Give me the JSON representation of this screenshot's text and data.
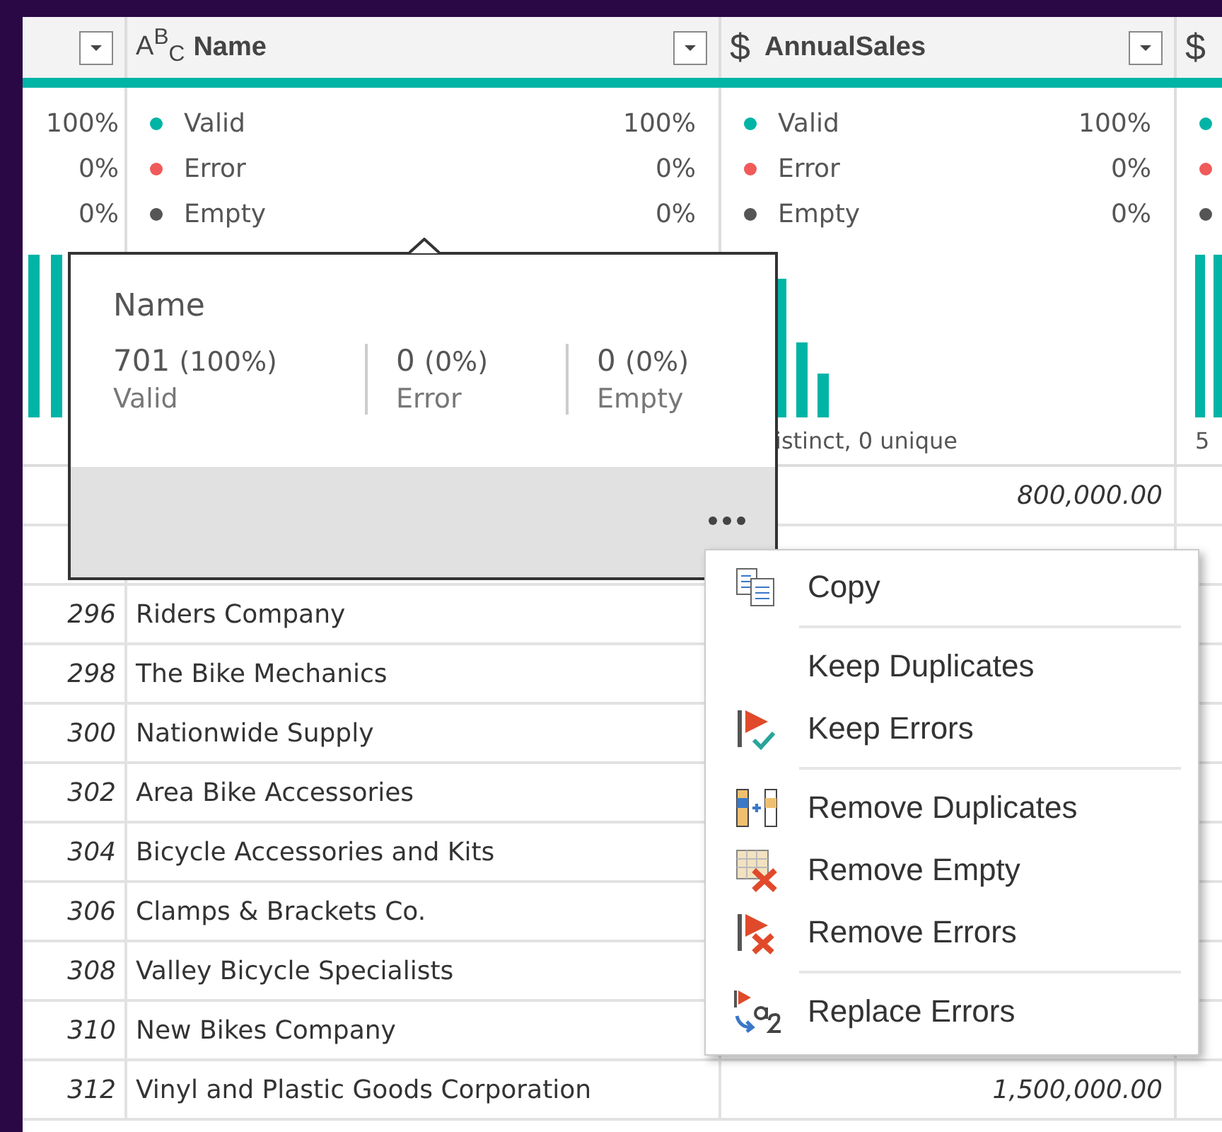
{
  "columns": [
    {
      "kind": "index",
      "stats": [
        {
          "percent": "100%"
        },
        {
          "percent": "0%"
        },
        {
          "percent": "0%"
        }
      ]
    },
    {
      "kind": "text",
      "type_icon": "A$^{B}$$_{C}$",
      "name": "Name",
      "stats": [
        {
          "label": "Valid",
          "percent": "100%",
          "color": "#00b4a6"
        },
        {
          "label": "Error",
          "percent": "0%",
          "color": "#f05a5a"
        },
        {
          "label": "Empty",
          "percent": "0%",
          "color": "#555555"
        }
      ]
    },
    {
      "kind": "currency",
      "type_icon": "$",
      "name": "AnnualSales",
      "stats": [
        {
          "label": "Valid",
          "percent": "100%",
          "color": "#00b4a6"
        },
        {
          "label": "Error",
          "percent": "0%",
          "color": "#f05a5a"
        },
        {
          "label": "Empty",
          "percent": "0%",
          "color": "#555555"
        }
      ],
      "footer": "istinct, 0 unique"
    },
    {
      "kind": "currency",
      "type_icon": "$",
      "stats": [
        {
          "color": "#00b4a6"
        },
        {
          "color": "#f05a5a"
        },
        {
          "color": "#555555"
        }
      ],
      "footer": "5"
    }
  ],
  "rows": [
    {
      "annual_sales": "800,000.00"
    },
    {},
    {
      "index": "296",
      "name": "Riders Company"
    },
    {
      "index": "298",
      "name": "The Bike Mechanics"
    },
    {
      "index": "300",
      "name": "Nationwide Supply"
    },
    {
      "index": "302",
      "name": "Area Bike Accessories"
    },
    {
      "index": "304",
      "name": "Bicycle Accessories and Kits"
    },
    {
      "index": "306",
      "name": "Clamps & Brackets Co."
    },
    {
      "index": "308",
      "name": "Valley Bicycle Specialists"
    },
    {
      "index": "310",
      "name": "New Bikes Company"
    },
    {
      "index": "312",
      "name": "Vinyl and Plastic Goods Corporation",
      "annual_sales": "1,500,000.00"
    }
  ],
  "popup": {
    "title": "Name",
    "stats": [
      {
        "value": "701",
        "percent": "(100%)",
        "label": "Valid"
      },
      {
        "value": "0",
        "percent": "(0%)",
        "label": "Error"
      },
      {
        "value": "0",
        "percent": "(0%)",
        "label": "Empty"
      }
    ]
  },
  "menu": {
    "groups": [
      [
        {
          "label": "Copy"
        }
      ],
      [
        {
          "label": "Keep Duplicates"
        },
        {
          "label": "Keep Errors"
        }
      ],
      [
        {
          "label": "Remove Duplicates"
        },
        {
          "label": "Remove Empty"
        },
        {
          "label": "Remove Errors"
        }
      ],
      [
        {
          "label": "Replace Errors"
        }
      ]
    ]
  }
}
